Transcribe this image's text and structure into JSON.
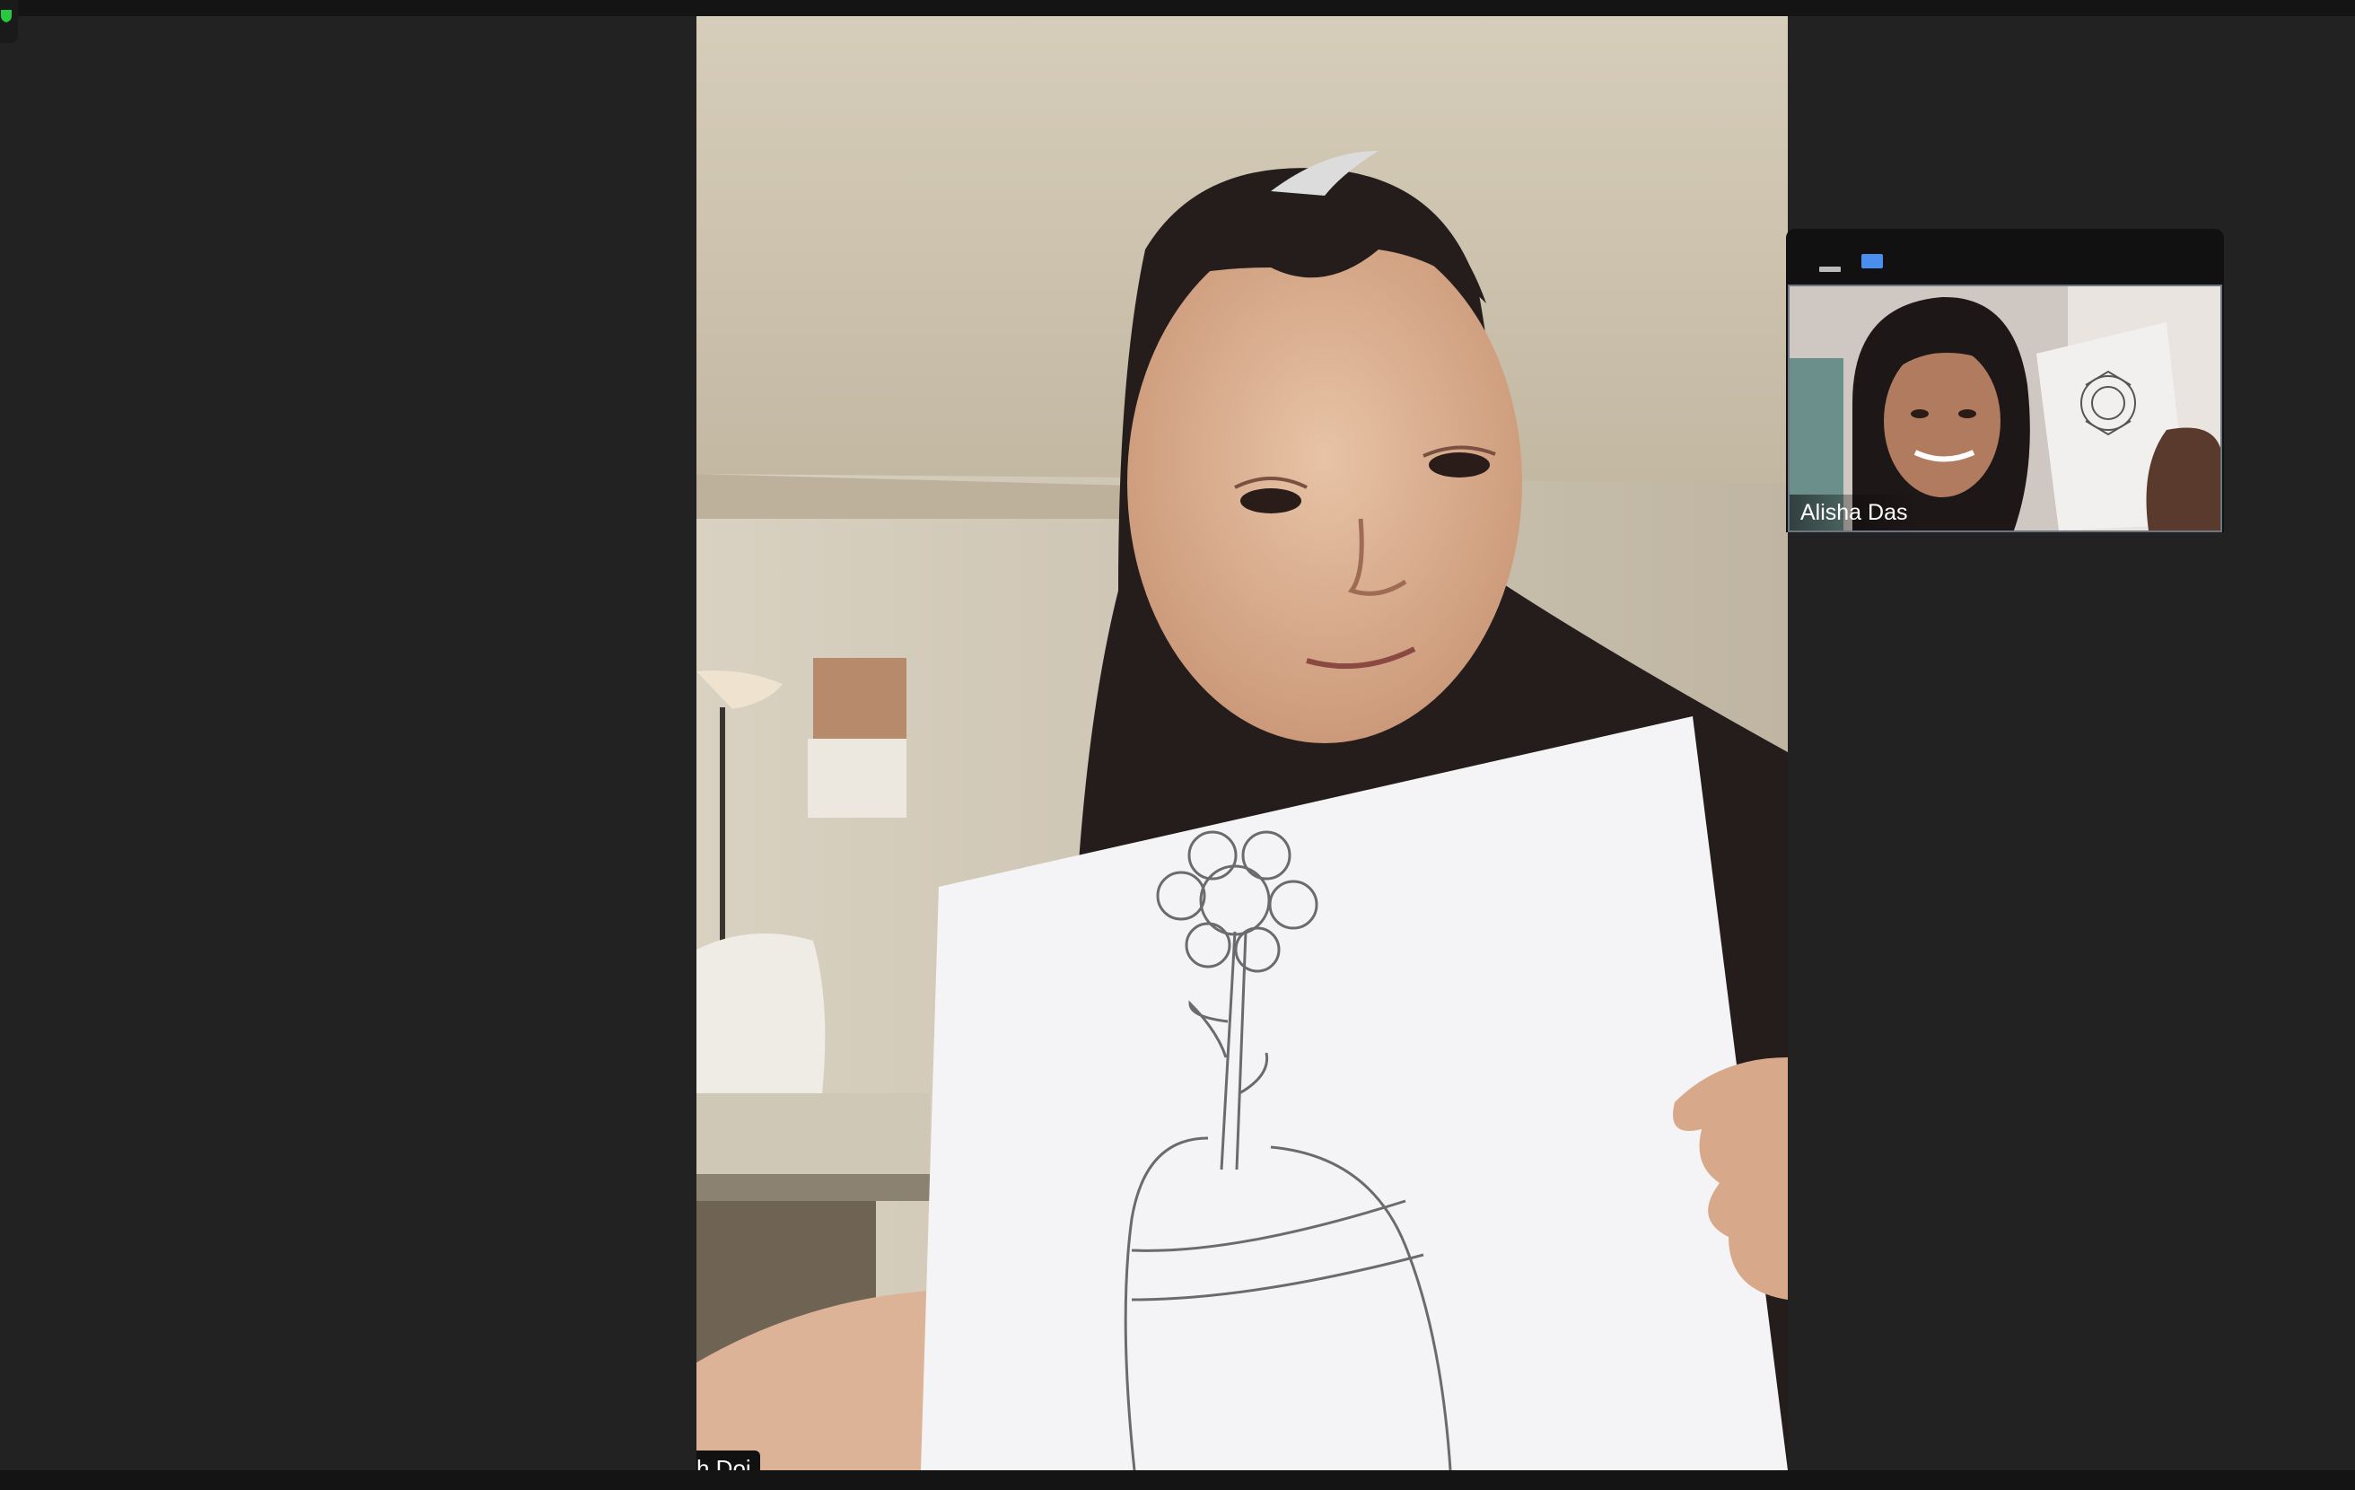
{
  "main_participant": {
    "name": "h Doi"
  },
  "floating_panel": {
    "participant": {
      "name": "Alisha Das"
    },
    "controls": {
      "minimize_icon": "minimize-icon",
      "view_icon": "gallery-view-icon"
    }
  },
  "colors": {
    "background": "#222222",
    "accent": "#4a8ff0"
  }
}
